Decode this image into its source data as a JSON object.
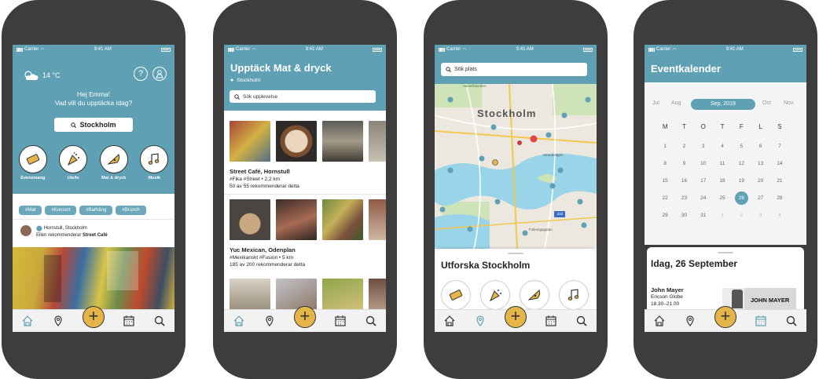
{
  "status": {
    "carrier": "Carrier",
    "time": "9:41 AM"
  },
  "colors": {
    "teal": "#5fa0b4",
    "accent": "#e6b54a",
    "frame": "#3d3d3d"
  },
  "screen1": {
    "temperature": "14 °C",
    "greeting": "Hej Emma!",
    "question": "Vad vill du upptäcka idag?",
    "location_button": "Stockholm",
    "categories": [
      {
        "label": "Evenemang",
        "icon": "ticket-icon"
      },
      {
        "label": "Uteliv",
        "icon": "party-popper-icon"
      },
      {
        "label": "Mat & dryck",
        "icon": "pizza-icon"
      },
      {
        "label": "Musik",
        "icon": "music-note-icon"
      }
    ],
    "tags": [
      "#Mat",
      "#Konsert",
      "#Barhäng",
      "#Brunch"
    ],
    "feed_location": "Hornstull, Stockholm",
    "feed_text_prefix": "Ellen rekommenderar ",
    "feed_text_place": "Street Café"
  },
  "screen2": {
    "title": "Upptäck Mat & dryck",
    "location": "Stockholm",
    "search_placeholder": "Sök upplevelse",
    "places": [
      {
        "name": "Street Café, Hornstull",
        "tags": "#Fika #Street • 2,2 km",
        "rec": "50 av 55 rekommenderar detta"
      },
      {
        "name": "Yuc Mexican, Odenplan",
        "tags": "#Mexikanskt #Fusion • 5 km",
        "rec": "185 av 200 rekommenderar detta"
      }
    ]
  },
  "screen3": {
    "search_placeholder": "Sök plats",
    "map_city": "Stockholm",
    "map_labels": [
      "Vanadislunden",
      "Strandvägen",
      "Folkungagatan"
    ],
    "road_badge": "222",
    "sheet_title": "Utforska Stockholm"
  },
  "screen4": {
    "title": "Eventkalender",
    "months": [
      "Jul",
      "Aug",
      "Sep, 2019",
      "Oct",
      "Nov"
    ],
    "weekdays": [
      "M",
      "T",
      "O",
      "T",
      "F",
      "L",
      "S"
    ],
    "days": [
      [
        "1",
        "2",
        "3",
        "4",
        "5",
        "6",
        "7"
      ],
      [
        "8",
        "9",
        "10",
        "11",
        "12",
        "13",
        "14"
      ],
      [
        "15",
        "16",
        "17",
        "18",
        "19",
        "20",
        "21"
      ],
      [
        "22",
        "23",
        "24",
        "25",
        "26",
        "27",
        "28"
      ],
      [
        "29",
        "30",
        "31",
        "1",
        "2",
        "3",
        "4"
      ]
    ],
    "selected_day": "26",
    "today_heading": "Idag, 26 September",
    "event_artist": "John Mayer",
    "event_venue": "Ericson Globe",
    "event_time": "18.30–21.00",
    "event_poster_text": "JOHN MAYER"
  }
}
